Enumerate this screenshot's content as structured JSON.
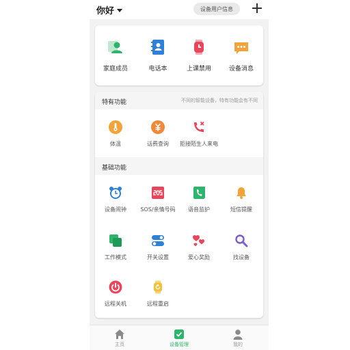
{
  "header": {
    "greeting": "你好",
    "device_info_button": "设备用户信息"
  },
  "quick_actions": [
    {
      "label": "家庭成员",
      "icon": "family-member-icon",
      "color": "#2cb56b"
    },
    {
      "label": "电话本",
      "icon": "phonebook-icon",
      "color": "#2f80d8"
    },
    {
      "label": "上课禁用",
      "icon": "class-disable-icon",
      "color": "#e8465b"
    },
    {
      "label": "设备消息",
      "icon": "message-icon",
      "color": "#f2a33a"
    }
  ],
  "special": {
    "title": "特有功能",
    "note": "不同的智能设备，特有功能会有不同",
    "items": [
      {
        "label": "体温",
        "icon": "thermometer-icon",
        "color": "#f2a33a"
      },
      {
        "label": "话费查询",
        "icon": "billing-icon",
        "color": "#f08a3a"
      },
      {
        "label": "拒接陌生人来电",
        "icon": "reject-call-icon",
        "color": "#e8465b"
      }
    ]
  },
  "basic": {
    "title": "基础功能",
    "items": [
      {
        "label": "设备闹钟",
        "icon": "alarm-clock-icon",
        "color": "#2f80d8"
      },
      {
        "label": "SOS/亲情号码",
        "icon": "sos-icon",
        "color": "#e8465b"
      },
      {
        "label": "语音监护",
        "icon": "voice-monitor-icon",
        "color": "#2cb56b"
      },
      {
        "label": "短信提醒",
        "icon": "bell-icon",
        "color": "#f2a33a"
      },
      {
        "label": "工作模式",
        "icon": "work-mode-icon",
        "color": "#2cb56b"
      },
      {
        "label": "开关设置",
        "icon": "switch-settings-icon",
        "color": "#2f80d8"
      },
      {
        "label": "爱心奖励",
        "icon": "hearts-icon",
        "color": "#e8465b"
      },
      {
        "label": "找设备",
        "icon": "search-icon",
        "color": "#7b5bd6"
      },
      {
        "label": "远程关机",
        "icon": "power-icon",
        "color": "#e8465b"
      },
      {
        "label": "远程重启",
        "icon": "watch-restart-icon",
        "color": "#f2c03a"
      }
    ]
  },
  "bottom_nav": [
    {
      "label": "主页",
      "icon": "home-icon",
      "active": false
    },
    {
      "label": "设备管理",
      "icon": "device-management-icon",
      "active": true
    },
    {
      "label": "我的",
      "icon": "profile-icon",
      "active": false
    }
  ]
}
